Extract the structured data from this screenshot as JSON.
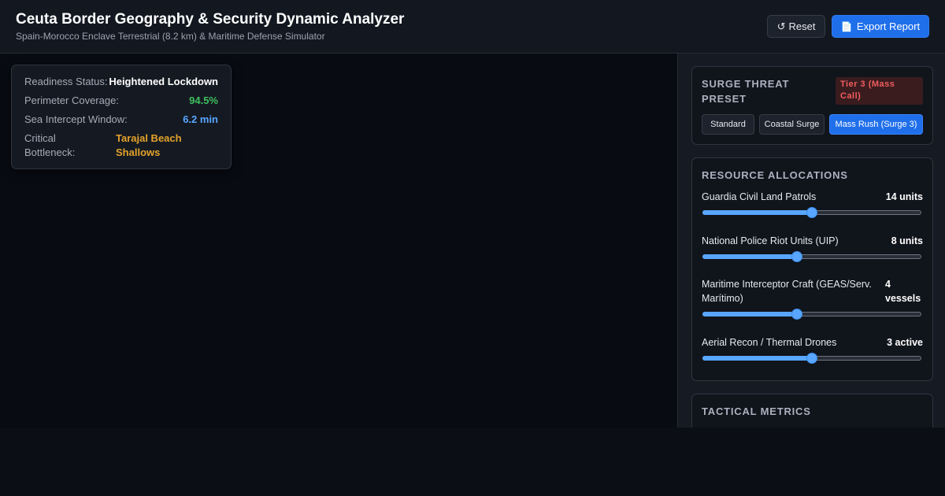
{
  "header": {
    "title": "Ceuta Border Geography & Security Dynamic Analyzer",
    "subtitle": "Spain-Morocco Enclave Terrestrial (8.2 km) & Maritime Defense Simulator",
    "reset_label": "Reset",
    "reset_icon": "↺",
    "export_label": "Export Report",
    "export_icon": "📄"
  },
  "status": {
    "readiness_label": "Readiness Status:",
    "readiness_value": "Heightened Lockdown",
    "coverage_label": "Perimeter Coverage:",
    "coverage_value": "94.5%",
    "intercept_label": "Sea Intercept Window:",
    "intercept_value": "6.2 min",
    "bottleneck_label": "Critical Bottleneck:",
    "bottleneck_value": "Tarajal Beach Shallows"
  },
  "surge": {
    "title": "Surge Threat Preset",
    "tier_badge": "Tier 3 (Mass Call)",
    "presets": [
      {
        "label": "Standard",
        "active": false
      },
      {
        "label": "Coastal Surge",
        "active": false
      },
      {
        "label": "Mass Rush (Surge 3)",
        "active": true
      }
    ]
  },
  "resources": {
    "title": "Resource Allocations",
    "items": [
      {
        "label": "Guardia Civil Land Patrols",
        "value": "14 units",
        "level": 0.5
      },
      {
        "label": "National Police Riot Units (UIP)",
        "value": "8 units",
        "level": 0.43
      },
      {
        "label": "Maritime Interceptor Craft (GEAS/Serv. Marítimo)",
        "value": "4 vessels",
        "level": 0.43
      },
      {
        "label": "Aerial Recon / Thermal Drones",
        "value": "3 active",
        "level": 0.5
      }
    ]
  },
  "metrics": {
    "title": "Tactical Metrics"
  },
  "colors": {
    "accent": "#1f6feb",
    "slider": "#58a6ff",
    "good": "#3fbf5f",
    "warning": "#e3a22b",
    "danger": "#f05d5e"
  }
}
